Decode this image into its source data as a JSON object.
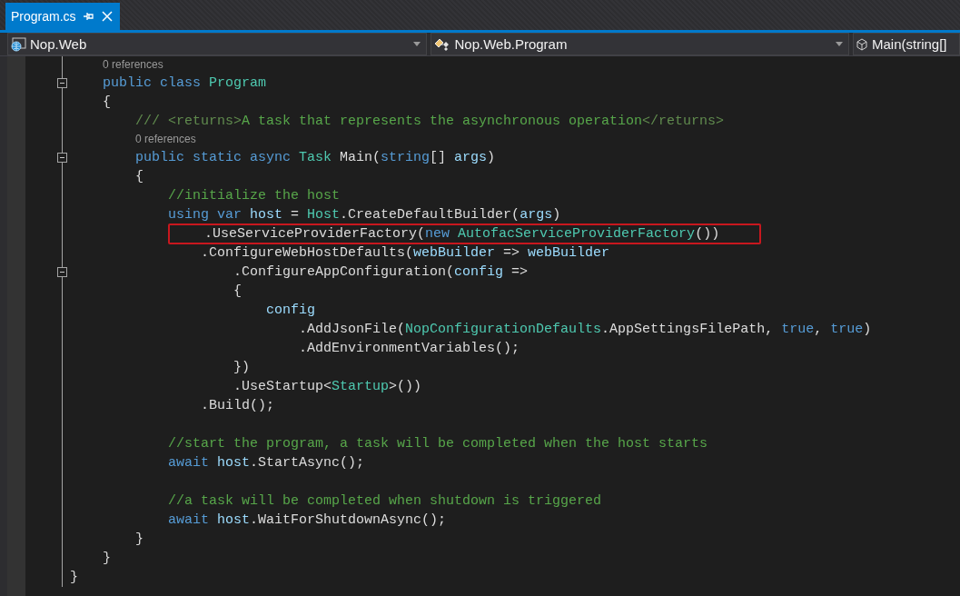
{
  "tabs": [
    {
      "label": "Program.cs",
      "selected": true,
      "pinned": true
    }
  ],
  "navigation": [
    {
      "kind": "project",
      "label": "Nop.Web"
    },
    {
      "kind": "class",
      "label": "Nop.Web.Program"
    },
    {
      "kind": "member",
      "label": "Main(string[]"
    }
  ],
  "code_lines": [
    {
      "kind": "codelens",
      "text": "    0 references"
    },
    {
      "kind": "code",
      "expanded": true,
      "tokens": [
        {
          "kind": "keyword",
          "text": "    public class "
        },
        {
          "kind": "type",
          "text": "Program"
        }
      ]
    },
    {
      "kind": "code",
      "tokens": [
        {
          "kind": "plain",
          "text": "    {"
        }
      ]
    },
    {
      "kind": "code",
      "tokens": [
        {
          "kind": "doc",
          "text": "        /// <returns>"
        },
        {
          "kind": "comment",
          "text": "A task that represents the asynchronous operation"
        },
        {
          "kind": "doc",
          "text": "</returns>"
        }
      ]
    },
    {
      "kind": "codelens",
      "text": "        0 references"
    },
    {
      "kind": "code",
      "expanded": true,
      "tokens": [
        {
          "kind": "keyword",
          "text": "        public static async "
        },
        {
          "kind": "type",
          "text": "Task "
        },
        {
          "kind": "plain",
          "text": "Main("
        },
        {
          "kind": "keyword",
          "text": "string"
        },
        {
          "kind": "plain",
          "text": "[] "
        },
        {
          "kind": "identifier",
          "text": "args"
        },
        {
          "kind": "plain",
          "text": ")"
        }
      ]
    },
    {
      "kind": "code",
      "tokens": [
        {
          "kind": "plain",
          "text": "        {"
        }
      ]
    },
    {
      "kind": "code",
      "tokens": [
        {
          "kind": "comment",
          "text": "            //initialize the host"
        }
      ]
    },
    {
      "kind": "code",
      "tokens": [
        {
          "kind": "keyword",
          "text": "            using var "
        },
        {
          "kind": "identifier",
          "text": "host"
        },
        {
          "kind": "plain",
          "text": " = "
        },
        {
          "kind": "type",
          "text": "Host"
        },
        {
          "kind": "plain",
          "text": ".CreateDefaultBuilder("
        },
        {
          "kind": "identifier",
          "text": "args"
        },
        {
          "kind": "plain",
          "text": ")"
        }
      ]
    },
    {
      "kind": "code",
      "highlighted": true,
      "tokens": [
        {
          "kind": "plain",
          "text": "                .UseServiceProviderFactory("
        },
        {
          "kind": "keyword",
          "text": "new "
        },
        {
          "kind": "type",
          "text": "AutofacServiceProviderFactory"
        },
        {
          "kind": "plain",
          "text": "())"
        }
      ]
    },
    {
      "kind": "code",
      "tokens": [
        {
          "kind": "plain",
          "text": "                .ConfigureWebHostDefaults("
        },
        {
          "kind": "identifier",
          "text": "webBuilder"
        },
        {
          "kind": "plain",
          "text": " => "
        },
        {
          "kind": "identifier",
          "text": "webBuilder"
        }
      ]
    },
    {
      "kind": "code",
      "expanded": true,
      "tokens": [
        {
          "kind": "plain",
          "text": "                    .ConfigureAppConfiguration("
        },
        {
          "kind": "identifier",
          "text": "config"
        },
        {
          "kind": "plain",
          "text": " =>"
        }
      ]
    },
    {
      "kind": "code",
      "tokens": [
        {
          "kind": "plain",
          "text": "                    {"
        }
      ]
    },
    {
      "kind": "code",
      "tokens": [
        {
          "kind": "identifier",
          "text": "                        config"
        }
      ]
    },
    {
      "kind": "code",
      "tokens": [
        {
          "kind": "plain",
          "text": "                            .AddJsonFile("
        },
        {
          "kind": "type",
          "text": "NopConfigurationDefaults"
        },
        {
          "kind": "plain",
          "text": ".AppSettingsFilePath, "
        },
        {
          "kind": "keyword",
          "text": "true"
        },
        {
          "kind": "plain",
          "text": ", "
        },
        {
          "kind": "keyword",
          "text": "true"
        },
        {
          "kind": "plain",
          "text": ")"
        }
      ]
    },
    {
      "kind": "code",
      "tokens": [
        {
          "kind": "plain",
          "text": "                            .AddEnvironmentVariables();"
        }
      ]
    },
    {
      "kind": "code",
      "tokens": [
        {
          "kind": "plain",
          "text": "                    })"
        }
      ]
    },
    {
      "kind": "code",
      "tokens": [
        {
          "kind": "plain",
          "text": "                    .UseStartup<"
        },
        {
          "kind": "type",
          "text": "Startup"
        },
        {
          "kind": "plain",
          "text": ">())"
        }
      ]
    },
    {
      "kind": "code",
      "tokens": [
        {
          "kind": "plain",
          "text": "                .Build();"
        }
      ]
    },
    {
      "kind": "blank"
    },
    {
      "kind": "code",
      "tokens": [
        {
          "kind": "comment",
          "text": "            //start the program, a task will be completed when the host starts"
        }
      ]
    },
    {
      "kind": "code",
      "tokens": [
        {
          "kind": "keyword",
          "text": "            await "
        },
        {
          "kind": "identifier",
          "text": "host"
        },
        {
          "kind": "plain",
          "text": ".StartAsync();"
        }
      ]
    },
    {
      "kind": "blank"
    },
    {
      "kind": "code",
      "tokens": [
        {
          "kind": "comment",
          "text": "            //a task will be completed when shutdown is triggered"
        }
      ]
    },
    {
      "kind": "code",
      "tokens": [
        {
          "kind": "keyword",
          "text": "            await "
        },
        {
          "kind": "identifier",
          "text": "host"
        },
        {
          "kind": "plain",
          "text": ".WaitForShutdownAsync();"
        }
      ]
    },
    {
      "kind": "code",
      "tokens": [
        {
          "kind": "plain",
          "text": "        }"
        }
      ]
    },
    {
      "kind": "code",
      "tokens": [
        {
          "kind": "plain",
          "text": "    }"
        }
      ]
    },
    {
      "kind": "code",
      "tokens": [
        {
          "kind": "plain",
          "text": "}"
        }
      ]
    }
  ]
}
